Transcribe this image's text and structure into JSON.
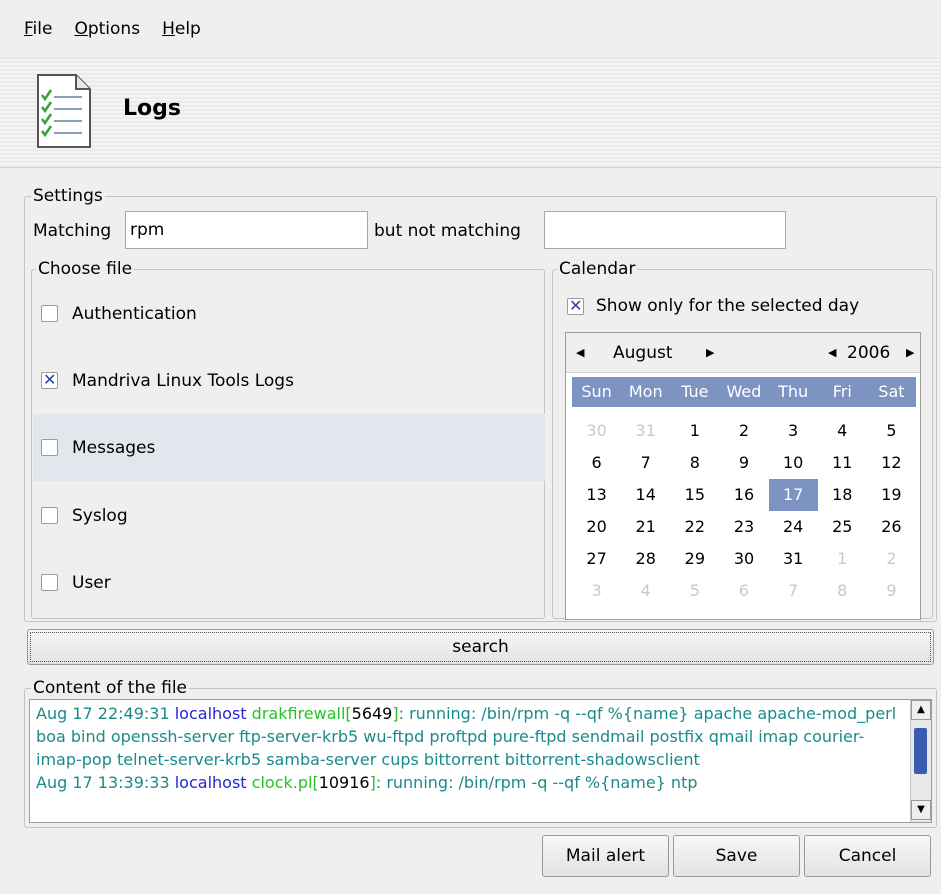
{
  "menu": {
    "file": "File",
    "options": "Options",
    "help": "Help",
    "file_mn": "F",
    "file_rest": "ile",
    "options_mn": "O",
    "options_rest": "ptions",
    "help_mn": "H",
    "help_rest": "elp"
  },
  "banner": {
    "title": "Logs",
    "icon": "log-list-icon"
  },
  "settings": {
    "legend": "Settings",
    "matching_label": "Matching",
    "matching_value": "rpm",
    "not_matching_label": "but not matching",
    "not_matching_value": ""
  },
  "choose_file": {
    "legend": "Choose file",
    "items": [
      {
        "label": "Authentication",
        "checked": false
      },
      {
        "label": "Mandriva Linux Tools Logs",
        "checked": true
      },
      {
        "label": "Messages",
        "checked": false
      },
      {
        "label": "Syslog",
        "checked": false
      },
      {
        "label": "User",
        "checked": false
      }
    ]
  },
  "calendar": {
    "legend": "Calendar",
    "show_only_label": "Show only for the selected day",
    "show_only_checked": true,
    "month": "August",
    "year": "2006",
    "weekdays": [
      "Sun",
      "Mon",
      "Tue",
      "Wed",
      "Thu",
      "Fri",
      "Sat"
    ],
    "days": [
      "30",
      "31",
      "1",
      "2",
      "3",
      "4",
      "5",
      "6",
      "7",
      "8",
      "9",
      "10",
      "11",
      "12",
      "13",
      "14",
      "15",
      "16",
      "17",
      "18",
      "19",
      "20",
      "21",
      "22",
      "23",
      "24",
      "25",
      "26",
      "27",
      "28",
      "29",
      "30",
      "31",
      "1",
      "2",
      "3",
      "4",
      "5",
      "6",
      "7",
      "8",
      "9"
    ],
    "selected_day": "17"
  },
  "search_button": "search",
  "content": {
    "legend": "Content of the file",
    "line1": {
      "date": "Aug 17 22:49:31",
      "host": "localhost",
      "proc": "drakfirewall",
      "pid": "5649",
      "msg": ": running: /bin/rpm -q --qf %{name} apache apache-mod_perl boa bind openssh-server ftp-server-krb5 wu-ftpd proftpd pure-ftpd sendmail postfix qmail imap courier-imap-pop telnet-server-krb5 samba-server cups bittorrent bittorrent-shadowsclient"
    },
    "line2": {
      "date": "Aug 17 13:39:33",
      "host": "localhost",
      "proc": "clock.pl",
      "pid": "10916",
      "msg": ": running: /bin/rpm -q --qf %{name} ntp"
    }
  },
  "buttons": {
    "mail_alert": "Mail alert",
    "save": "Save",
    "cancel": "Cancel"
  },
  "colors": {
    "accent": "#7d93c1",
    "log_date": "#1b8a8a",
    "log_host": "#2424d6",
    "log_proc": "#28c228"
  }
}
